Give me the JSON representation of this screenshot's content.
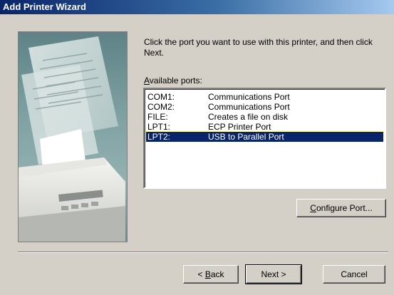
{
  "window": {
    "title": "Add Printer Wizard"
  },
  "instruction": "Click the port you want to use with this printer, and then click Next.",
  "ports_label": {
    "accel": "A",
    "rest": "vailable ports:"
  },
  "ports": [
    {
      "name": "COM1:",
      "description": "Communications Port",
      "selected": false
    },
    {
      "name": "COM2:",
      "description": "Communications Port",
      "selected": false
    },
    {
      "name": "FILE:",
      "description": "Creates a file on disk",
      "selected": false
    },
    {
      "name": "LPT1:",
      "description": "ECP Printer Port",
      "selected": false
    },
    {
      "name": "LPT2:",
      "description": "USB to Parallel Port",
      "selected": true
    }
  ],
  "buttons": {
    "configure": {
      "accel": "C",
      "rest": "onfigure Port..."
    },
    "back": {
      "prefix": "< ",
      "accel": "B",
      "rest": "ack"
    },
    "next": {
      "label": "Next >"
    },
    "cancel": {
      "label": "Cancel"
    }
  },
  "colors": {
    "titlebar_start": "#0a246a",
    "titlebar_end": "#a6caf0",
    "selection": "#0a246a",
    "face": "#d4d0c8"
  }
}
